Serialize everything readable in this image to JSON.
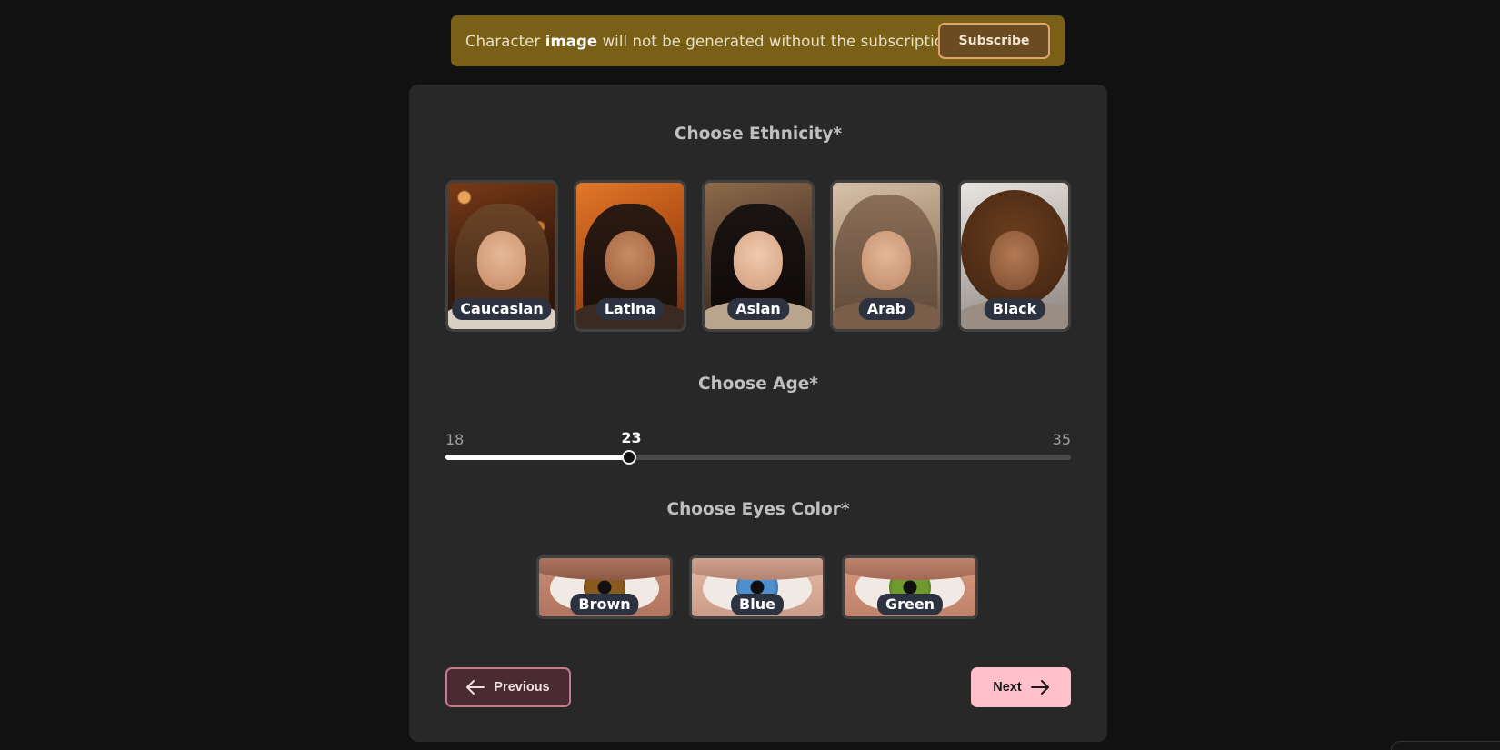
{
  "banner": {
    "text_before": "Character ",
    "text_bold": "image",
    "text_after": " will not be generated without the subscription",
    "subscribe_label": "Subscribe"
  },
  "ethnicity": {
    "title": "Choose Ethnicity*",
    "options": [
      {
        "label": "Caucasian"
      },
      {
        "label": "Latina"
      },
      {
        "label": "Asian"
      },
      {
        "label": "Arab"
      },
      {
        "label": "Black"
      }
    ]
  },
  "age": {
    "title": "Choose Age*",
    "min": "18",
    "max": "35",
    "value": "23",
    "fraction": 0.2941
  },
  "eyes": {
    "title": "Choose Eyes Color*",
    "options": [
      {
        "label": "Brown",
        "iris_color": "#8a5a1c"
      },
      {
        "label": "Blue",
        "iris_color": "#4d8fcf"
      },
      {
        "label": "Green",
        "iris_color": "#6f9a2c"
      }
    ]
  },
  "nav": {
    "previous_label": "Previous",
    "previous_icon": "arrow-left-icon",
    "next_label": "Next",
    "next_icon": "arrow-right-icon"
  },
  "colors": {
    "banner_bg": "#7a5f16",
    "card_bg": "#282828",
    "next_bg": "#ffc0cc",
    "prev_border": "#c97b8e"
  }
}
